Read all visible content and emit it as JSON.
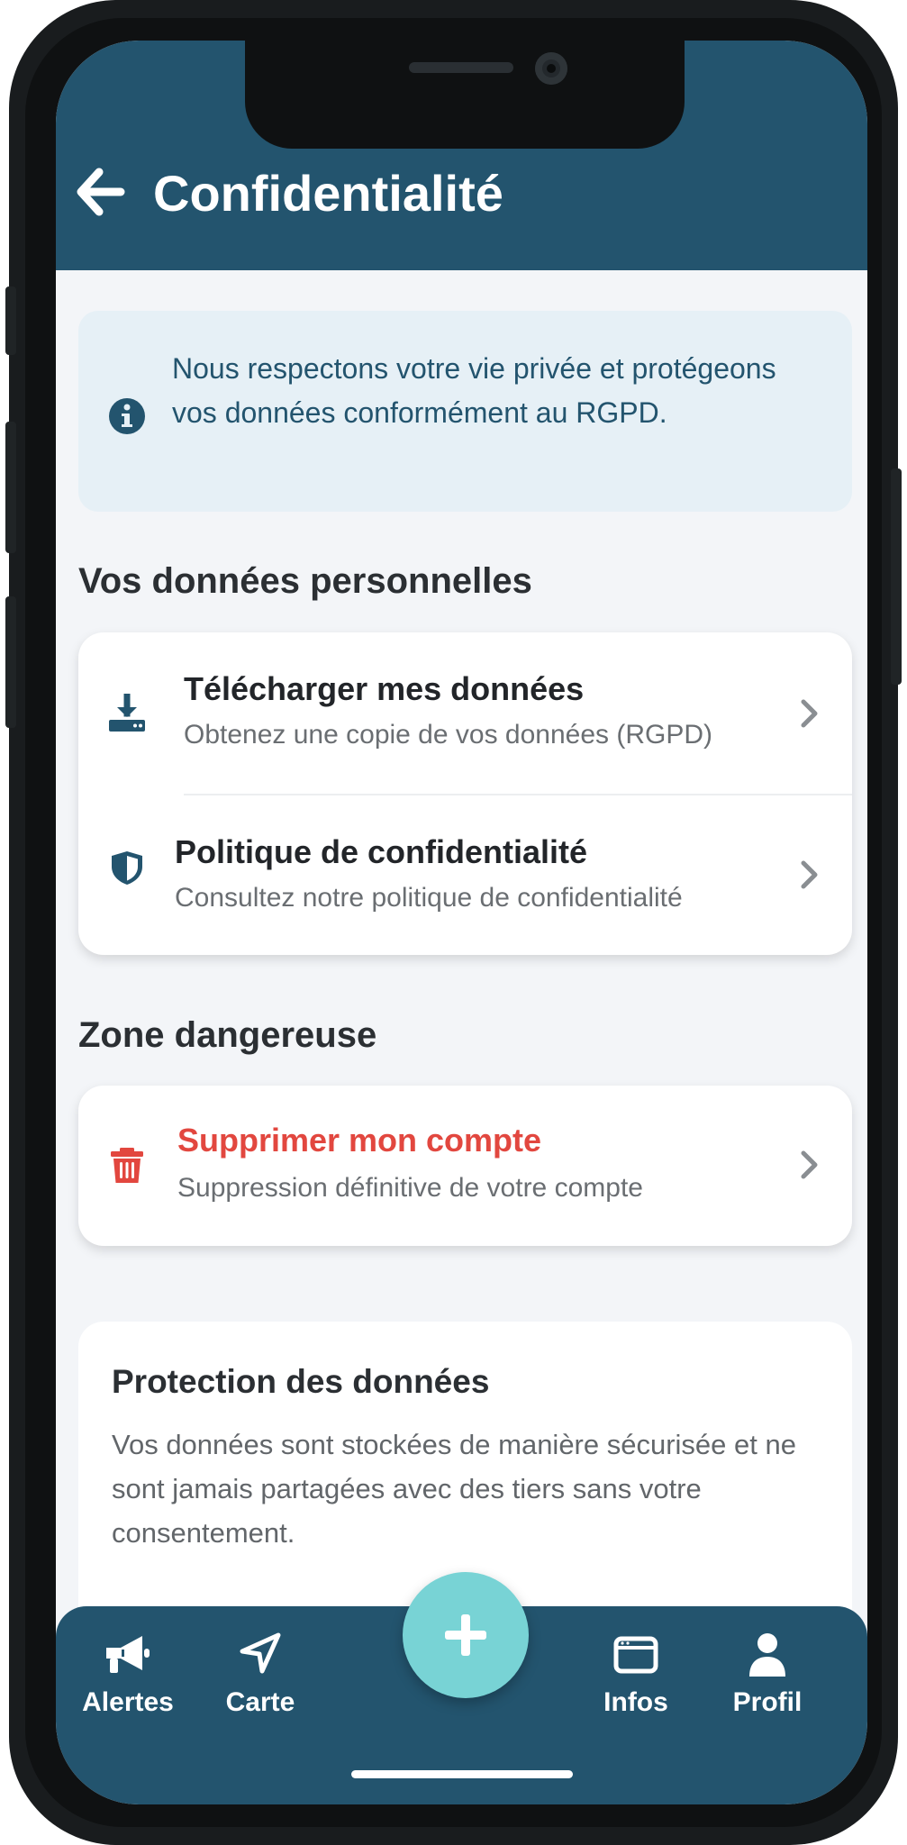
{
  "header": {
    "title": "Confidentialité"
  },
  "info_banner": {
    "text": "Nous respectons votre vie privée et protégeons vos données conformément au RGPD."
  },
  "personal_data": {
    "section_title": "Vos données personnelles",
    "items": [
      {
        "title": "Télécharger mes données",
        "subtitle": "Obtenez une copie de vos données (RGPD)",
        "icon": "download-icon"
      },
      {
        "title": "Politique de confidentialité",
        "subtitle": "Consultez notre politique de confidentialité",
        "icon": "shield-icon"
      }
    ]
  },
  "danger_zone": {
    "section_title": "Zone dangereuse",
    "items": [
      {
        "title": "Supprimer mon compte",
        "subtitle": "Suppression définitive de votre compte",
        "icon": "trash-icon"
      }
    ]
  },
  "protection": {
    "title": "Protection des données",
    "body": "Vos données sont stockées de manière sécurisée et ne sont jamais partagées avec des tiers sans votre consentement."
  },
  "bottom_nav": {
    "items": [
      {
        "label": "Alertes",
        "icon": "megaphone-icon"
      },
      {
        "label": "Carte",
        "icon": "navigation-icon"
      },
      {
        "label": "Infos",
        "icon": "window-icon"
      },
      {
        "label": "Profil",
        "icon": "user-icon"
      }
    ],
    "fab_icon": "plus-icon"
  },
  "colors": {
    "primary": "#23546e",
    "accent": "#78d3d5",
    "danger": "#e2473f",
    "background": "#f3f5f8",
    "banner_bg": "#e6f0f6"
  }
}
